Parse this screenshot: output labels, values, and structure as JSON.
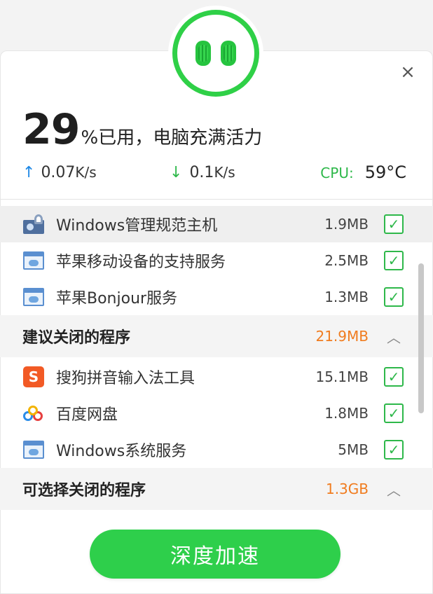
{
  "close_icon": "×",
  "usage": {
    "percent": "29",
    "text": "%已用，电脑充满活力"
  },
  "stats": {
    "upload_arrow": "↑",
    "upload_value": "0.07",
    "upload_unit": "K/s",
    "download_arrow": "↓",
    "download_value": "0.1",
    "download_unit": "K/s",
    "cpu_label": "CPU:",
    "cpu_value": "59°C"
  },
  "rows_top": [
    {
      "name": "Windows管理规范主机",
      "size": "1.9MB",
      "icon": "gear-host-icon"
    },
    {
      "name": "苹果移动设备的支持服务",
      "size": "2.5MB",
      "icon": "window-service-icon"
    },
    {
      "name": "苹果Bonjour服务",
      "size": "1.3MB",
      "icon": "window-service-icon"
    }
  ],
  "section_recommended": {
    "title": "建议关闭的程序",
    "size": "21.9MB",
    "caret": "︿"
  },
  "rows_recommended": [
    {
      "name": "搜狗拼音输入法工具",
      "size": "15.1MB",
      "icon": "sogou-icon",
      "icon_glyph": "S"
    },
    {
      "name": "百度网盘",
      "size": "1.8MB",
      "icon": "baidu-netdisk-icon"
    },
    {
      "name": "Windows系统服务",
      "size": "5MB",
      "icon": "window-service-icon"
    }
  ],
  "section_optional": {
    "title": "可选择关闭的程序",
    "size": "1.3GB",
    "caret": "︿"
  },
  "check_glyph": "✓",
  "boost_button": "深度加速",
  "colors": {
    "accent_green": "#2ecf4b",
    "orange": "#f07c1f",
    "blue": "#1e88e5"
  }
}
